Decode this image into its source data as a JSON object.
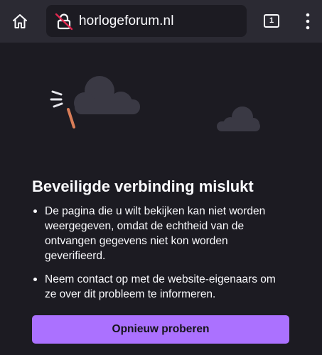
{
  "toolbar": {
    "url": "horlogeforum.nl",
    "tab_count": "1",
    "home_icon": "home-icon",
    "security_icon": "insecure-lock-icon",
    "menu_icon": "kebab-menu-icon"
  },
  "error_page": {
    "title": "Beveiligde verbinding mislukt",
    "bullets": [
      "De pagina die u wilt bekijken kan niet worden weergegeven, omdat de echtheid van de ontvangen gegevens niet kon worden geverifieerd.",
      "Neem contact op met de website-eigenaars om ze over dit probleem te informeren."
    ],
    "retry_label": "Opnieuw proberen"
  },
  "colors": {
    "background": "#1c1b22",
    "toolbar": "#2b2a33",
    "accent": "#ab71ff",
    "text": "#fbfbfe"
  }
}
